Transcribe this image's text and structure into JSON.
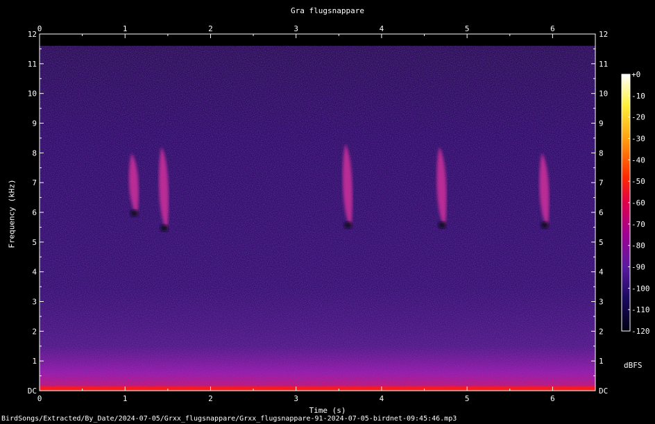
{
  "chart_data": {
    "type": "heatmap",
    "title": "Gra flugsnappare",
    "xlabel": "Time (s)",
    "ylabel": "Frequency (kHz)",
    "xlim": [
      0,
      6.5
    ],
    "ylim": [
      0,
      12
    ],
    "x_ticks": [
      "0",
      "1",
      "2",
      "3",
      "4",
      "5",
      "6"
    ],
    "y_ticks": [
      "DC",
      "1",
      "2",
      "3",
      "4",
      "5",
      "6",
      "7",
      "8",
      "9",
      "10",
      "11",
      "12"
    ],
    "colorbar": {
      "unit": "dBFS",
      "range": [
        -120,
        0
      ],
      "ticks": [
        "+0",
        "-10",
        "-20",
        "-30",
        "-40",
        "-50",
        "-60",
        "-70",
        "-80",
        "-90",
        "-100",
        "-110",
        "-120"
      ]
    },
    "noise_cutoff_khz": 11.6,
    "calls": [
      {
        "t": 1.1,
        "f_low": 5.9,
        "f_high": 8.0
      },
      {
        "t": 1.45,
        "f_low": 5.4,
        "f_high": 8.2
      },
      {
        "t": 3.6,
        "f_low": 5.5,
        "f_high": 8.3
      },
      {
        "t": 4.7,
        "f_low": 5.5,
        "f_high": 8.2
      },
      {
        "t": 5.9,
        "f_low": 5.5,
        "f_high": 8.0
      }
    ],
    "colors": {
      "background_noise": "#2b0f63",
      "low_freq_energy": "#9a1aa8",
      "dc_band": "#ff1a10",
      "call": "#d8309e"
    }
  },
  "file_path": "BirdSongs/Extracted/By_Date/2024-07-05/Grxx_flugsnappare/Grxx_flugsnappare-91-2024-07-05-birdnet-09:45:46.mp3"
}
